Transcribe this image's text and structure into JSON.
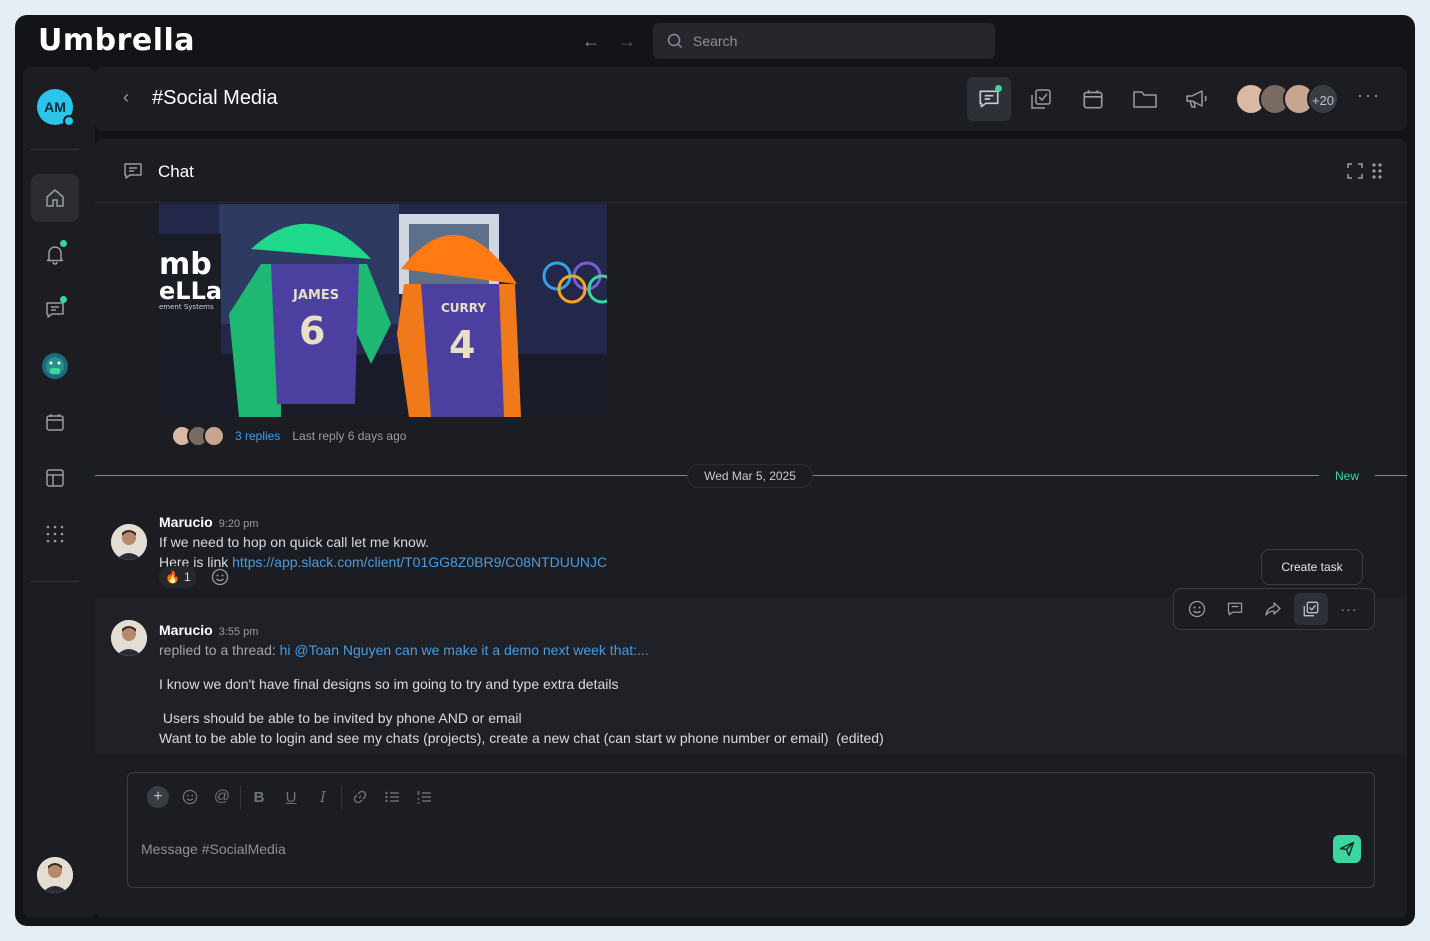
{
  "app": {
    "logo": "Umbrella"
  },
  "topbar": {
    "search_placeholder": "Search"
  },
  "user": {
    "initials": "AM"
  },
  "channel": {
    "title": "#Social Media"
  },
  "chat": {
    "title": "Chat"
  },
  "thread": {
    "replies": "3 replies",
    "last_reply": "Last reply 6 days ago"
  },
  "members": {
    "extra_count": "+20"
  },
  "divider": {
    "date": "Wed Mar 5, 2025",
    "new_label": "New"
  },
  "messages": [
    {
      "author": "Marucio",
      "time": "9:20 pm",
      "line1": "If we need to hop on quick call let me know.",
      "link_prefix": "Here is link ",
      "link": "https://app.slack.com/client/T01GG8Z0BR9/C08NTDUUNJC",
      "reaction_emoji": "🔥",
      "reaction_count": "1"
    },
    {
      "author": "Marucio",
      "time": "3:55 pm",
      "thread_prefix": "replied to a thread: ",
      "thread_link": "hi @Toan Nguyen can we make it a demo next week that:...",
      "line1": "I know we don't have final designs so im going to try and type extra details",
      "line2": " Users should be able to be invited by phone AND or email",
      "line3": "Want to be able to login and see my chats (projects), create a new chat (can start w phone number or email)  (edited)"
    }
  ],
  "hover": {
    "tooltip": "Create task"
  },
  "composer": {
    "placeholder": "Message #SocialMedia"
  },
  "image": {
    "brand_top": "mb",
    "brand_mid": "eLLa",
    "brand_sub": "ement Systems",
    "jersey1_name": "JAMES",
    "jersey1_number": "6",
    "jersey2_name": "CURRY",
    "jersey2_number": "4"
  },
  "colors": {
    "accent": "#3ad6a0",
    "link": "#4a9be0",
    "bg": "#1c1d22"
  }
}
